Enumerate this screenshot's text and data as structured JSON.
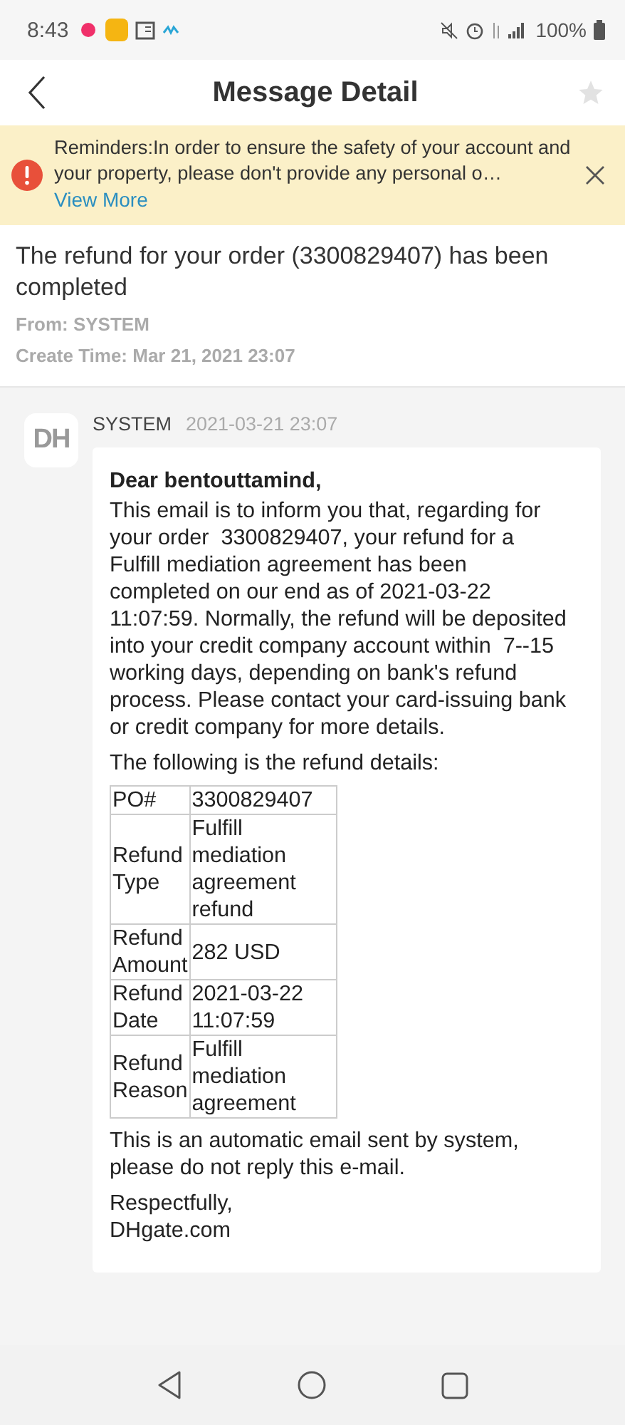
{
  "status_bar": {
    "time": "8:43",
    "battery": "100%"
  },
  "header": {
    "title": "Message Detail",
    "starred": false
  },
  "reminder": {
    "text": "Reminders:In order to ensure the safety of your account and your property, please don't provide any personal o…",
    "link": "View More"
  },
  "message": {
    "subject": "The refund for your order (3300829407) has been completed",
    "from": "From: SYSTEM",
    "create_time": "Create Time: Mar 21, 2021 23:07"
  },
  "chat": {
    "avatar": "DH",
    "sender": "SYSTEM",
    "time": "2021-03-21 23:07",
    "greeting": "Dear bentouttamind,",
    "body": "This email is to inform you that, regarding for your order  3300829407, your refund for a Fulfill mediation agreement has been completed on our end as of 2021-03-22 11:07:59. Normally, the refund will be deposited into your credit company account within  7--15 working days, depending on bank's refund process. Please contact your card-issuing bank or credit company for more details.",
    "table_intro": "The following is the refund details:",
    "table": [
      {
        "label": "PO#",
        "value": "3300829407"
      },
      {
        "label": "Refund Type",
        "value": "Fulfill mediation agreement refund"
      },
      {
        "label": "Refund Amount",
        "value": "282 USD"
      },
      {
        "label": "Refund Date",
        "value": "2021-03-22 11:07:59"
      },
      {
        "label": "Refund Reason",
        "value": "Fulfill mediation agreement"
      }
    ],
    "footer": "This is an automatic email sent by system, please do not reply this e-mail.",
    "signoff": "Respectfully,",
    "signature": "DHgate.com"
  }
}
